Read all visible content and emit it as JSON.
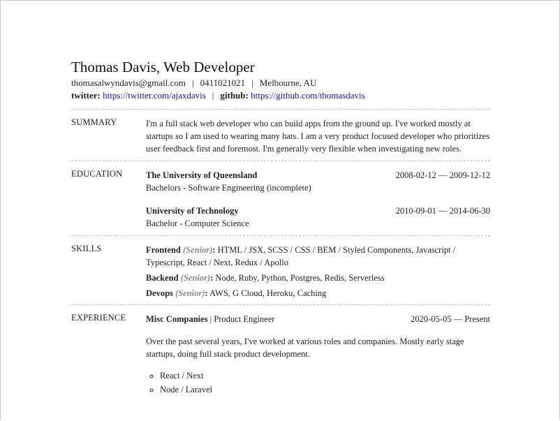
{
  "name": "Thomas Davis, Web Developer",
  "contact": {
    "email": "thomasalwyndavis@gmail.com",
    "phone": "0411021021",
    "location": "Melbourne, AU",
    "twitter_label": "twitter:",
    "twitter_url": "https://twitter.com/ajaxdavis",
    "github_label": "github:",
    "github_url": "https://github.com/thomasdavis"
  },
  "summary": {
    "label": "SUMMARY",
    "text": "I'm a full stack web developer who can build apps from the ground up. I've worked mostly at startups so I am used to wearing many hats. I am a very product focused developer who prioritizes user feedback first and foremost. I'm generally very flexible when investigating new roles."
  },
  "education": {
    "label": "EDUCATION",
    "items": [
      {
        "institution": "The University of Queensland",
        "dates": "2008-02-12 — 2009-12-12",
        "degree": "Bachelors - Software Engineering (incomplete)"
      },
      {
        "institution": "University of Technology",
        "dates": "2010-09-01 — 2014-06-30",
        "degree": "Bachelor - Computer Science"
      }
    ]
  },
  "skills": {
    "label": "SKILLS",
    "items": [
      {
        "name": "Frontend",
        "level": "(Senior)",
        "keywords": "HTML / JSX, SCSS / CSS / BEM / Styled Components, Javascript / Typescript, React / Next, Redux / Apollo"
      },
      {
        "name": "Backend",
        "level": "(Senior)",
        "keywords": "Node, Ruby, Python, Postgres, Redis, Serverless"
      },
      {
        "name": "Devops",
        "level": "(Senior)",
        "keywords": "AWS, G Cloud, Heroku, Caching"
      }
    ]
  },
  "experience": {
    "label": "EXPERIENCE",
    "items": [
      {
        "company": "Misc Companies",
        "position": "Product Engineer",
        "dates": "2020-05-05 — Present",
        "summary": "Over the past several years, I've worked at various roles and companies. Mostly early stage startups, doing full stack product development.",
        "highlights": [
          "React / Next",
          "Node / Laravel"
        ]
      }
    ]
  }
}
